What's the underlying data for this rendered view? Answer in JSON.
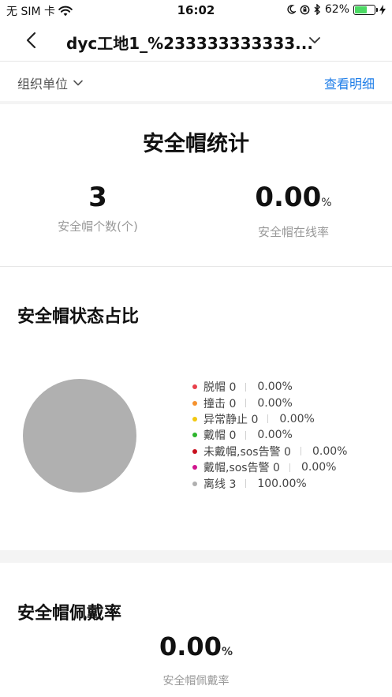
{
  "status_bar": {
    "carrier": "无 SIM 卡",
    "time": "16:02",
    "battery": "62%",
    "battery_level": 0.62,
    "icons": [
      "wifi-icon",
      "moon-icon",
      "orientation-lock-icon",
      "bluetooth-icon",
      "battery-icon",
      "charging-icon"
    ]
  },
  "nav": {
    "title": "dyc工地1_%233333333333...",
    "icons": [
      "back-chevron-icon",
      "chevron-down-icon"
    ]
  },
  "filter": {
    "org_label": "组织单位",
    "detail_link": "查看明细"
  },
  "helmet_stats": {
    "title": "安全帽统计",
    "count_value": "3",
    "count_label": "安全帽个数(个)",
    "online_value": "0.00",
    "online_unit": "%",
    "online_label": "安全帽在线率"
  },
  "status_ratio": {
    "title": "安全帽状态占比",
    "legend": [
      {
        "label": "脱帽 0",
        "percent": "0.00%",
        "color": "#e8414b"
      },
      {
        "label": "撞击 0",
        "percent": "0.00%",
        "color": "#f5922f"
      },
      {
        "label": "异常静止 0",
        "percent": "0.00%",
        "color": "#f2c811"
      },
      {
        "label": "戴帽 0",
        "percent": "0.00%",
        "color": "#2db52d"
      },
      {
        "label": "未戴帽,sos告警 0",
        "percent": "0.00%",
        "color": "#c8101e"
      },
      {
        "label": "戴帽,sos告警 0",
        "percent": "0.00%",
        "color": "#d1168e"
      },
      {
        "label": "离线 3",
        "percent": "100.00%",
        "color": "#b0b0b0"
      }
    ]
  },
  "wear_rate": {
    "title": "安全帽佩戴率",
    "value": "0.00",
    "unit": "%",
    "label": "安全帽佩戴率"
  }
}
